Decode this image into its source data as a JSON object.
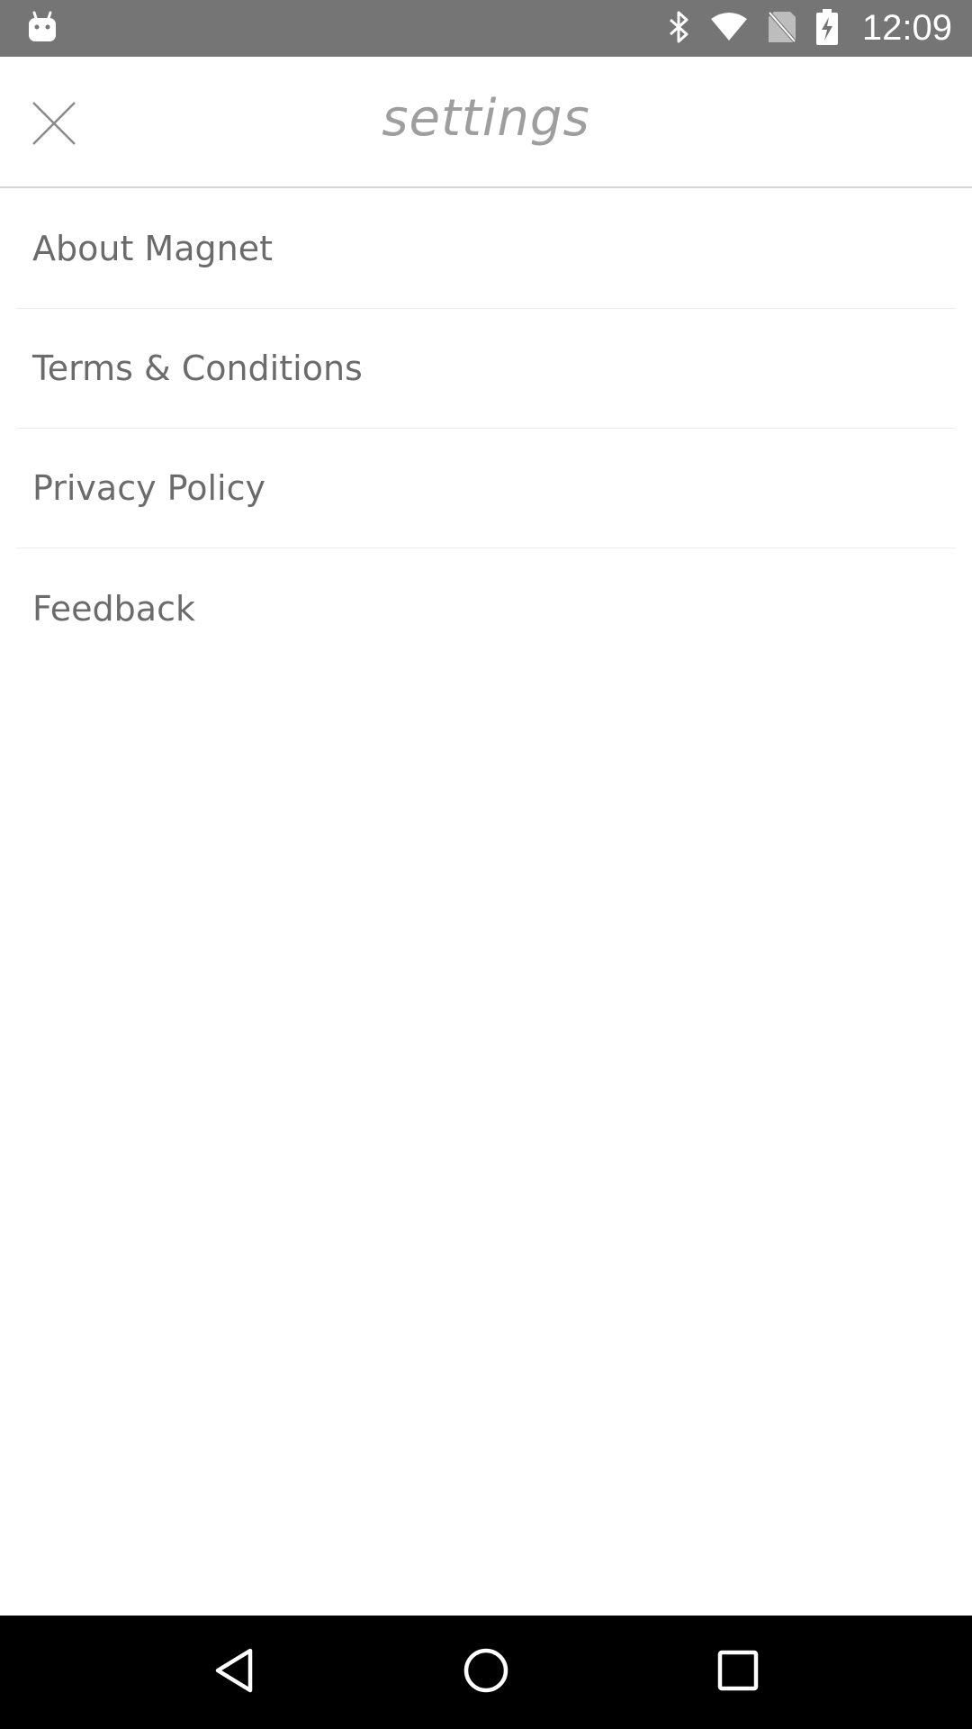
{
  "status_bar": {
    "time": "12:09",
    "icons": [
      "android-notification-icon",
      "bluetooth-icon",
      "wifi-icon",
      "no-sim-icon",
      "battery-charging-icon"
    ]
  },
  "header": {
    "title": "settings",
    "close_icon": "close-icon"
  },
  "menu": {
    "items": [
      {
        "label": "About Magnet"
      },
      {
        "label": "Terms & Conditions"
      },
      {
        "label": "Privacy Policy"
      },
      {
        "label": "Feedback"
      }
    ]
  },
  "nav_bar": {
    "icons": [
      "back-icon",
      "home-icon",
      "recents-icon"
    ]
  },
  "colors": {
    "status_bar_bg": "#757575",
    "text": "#6b6b6b",
    "title": "#9e9e9e",
    "divider": "#ececec",
    "nav_bar_bg": "#000000"
  }
}
